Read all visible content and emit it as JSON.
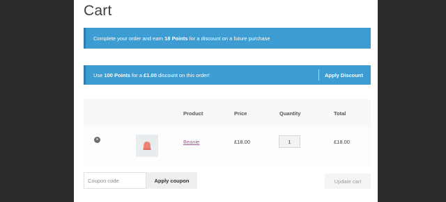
{
  "page": {
    "title": "Cart"
  },
  "notices": {
    "earn": {
      "pre": "Complete your order and earn ",
      "points": "18 Points",
      "post": " for a discount on a future purchase"
    },
    "redeem": {
      "pre": "Use ",
      "points": "100 Points",
      "mid": " for a ",
      "amount": "£1.00",
      "post": " discount on this order!",
      "apply_label": "Apply Discount"
    }
  },
  "table": {
    "headers": {
      "product": "Product",
      "price": "Price",
      "quantity": "Quantity",
      "total": "Total"
    },
    "rows": [
      {
        "name": "Beanie",
        "price": "£18.00",
        "quantity": "1",
        "total": "£18.00",
        "remove_icon": "close-circle-icon",
        "thumb_icon": "beanie-thumbnail"
      }
    ]
  },
  "coupon": {
    "placeholder": "Coupon code",
    "apply_label": "Apply coupon"
  },
  "update_label": "Update cart",
  "colors": {
    "notice_bg": "#3d9cd2",
    "link": "#9a5a8e"
  }
}
